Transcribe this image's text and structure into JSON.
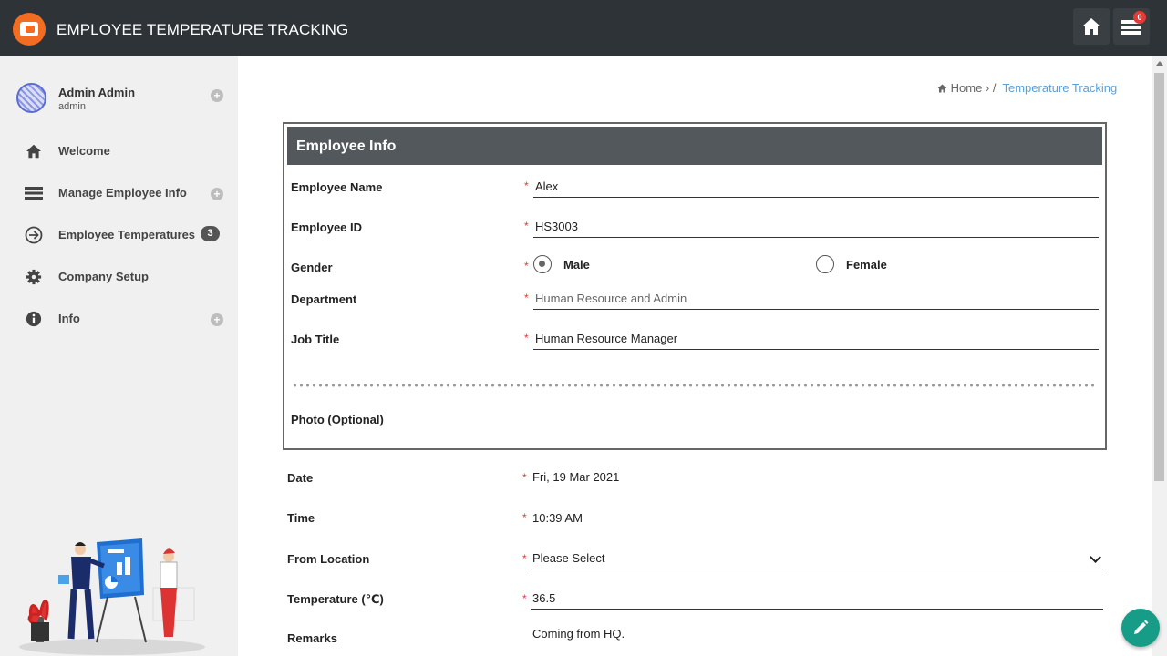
{
  "app": {
    "title": "EMPLOYEE TEMPERATURE TRACKING",
    "notification_count": "0"
  },
  "user": {
    "name": "Admin Admin",
    "role": "admin"
  },
  "sidebar": {
    "items": [
      {
        "label": "Welcome",
        "icon": "home-icon"
      },
      {
        "label": "Manage Employee Info",
        "icon": "list-icon"
      },
      {
        "label": "Employee Temperatures",
        "icon": "arrow-circle-icon",
        "badge": "3"
      },
      {
        "label": "Company Setup",
        "icon": "gear-icon"
      },
      {
        "label": "Info",
        "icon": "info-icon"
      }
    ]
  },
  "breadcrumb": {
    "home": "Home",
    "separator": "/",
    "current": "Temperature Tracking"
  },
  "employee_info": {
    "header": "Employee Info",
    "name_label": "Employee Name",
    "name_value": "Alex",
    "id_label": "Employee ID",
    "id_value": "HS3003",
    "gender_label": "Gender",
    "gender_options": [
      "Male",
      "Female"
    ],
    "gender_selected": "Male",
    "department_label": "Department",
    "department_value": "Human Resource and Admin",
    "job_label": "Job Title",
    "job_value": "Human Resource Manager",
    "photo_label": "Photo (Optional)"
  },
  "record": {
    "date_label": "Date",
    "date_value": "Fri, 19 Mar 2021",
    "time_label": "Time",
    "time_value": "10:39 AM",
    "location_label": "From Location",
    "location_value": "Please Select",
    "temp_label": "Temperature (℃)",
    "temp_value": "36.5",
    "remarks_label": "Remarks",
    "remarks_value": "Coming from HQ."
  },
  "colors": {
    "topbar": "#2e3338",
    "accent": "#f26c21",
    "fab": "#169c87",
    "required": "#e53935",
    "link": "#5aa0d8"
  }
}
